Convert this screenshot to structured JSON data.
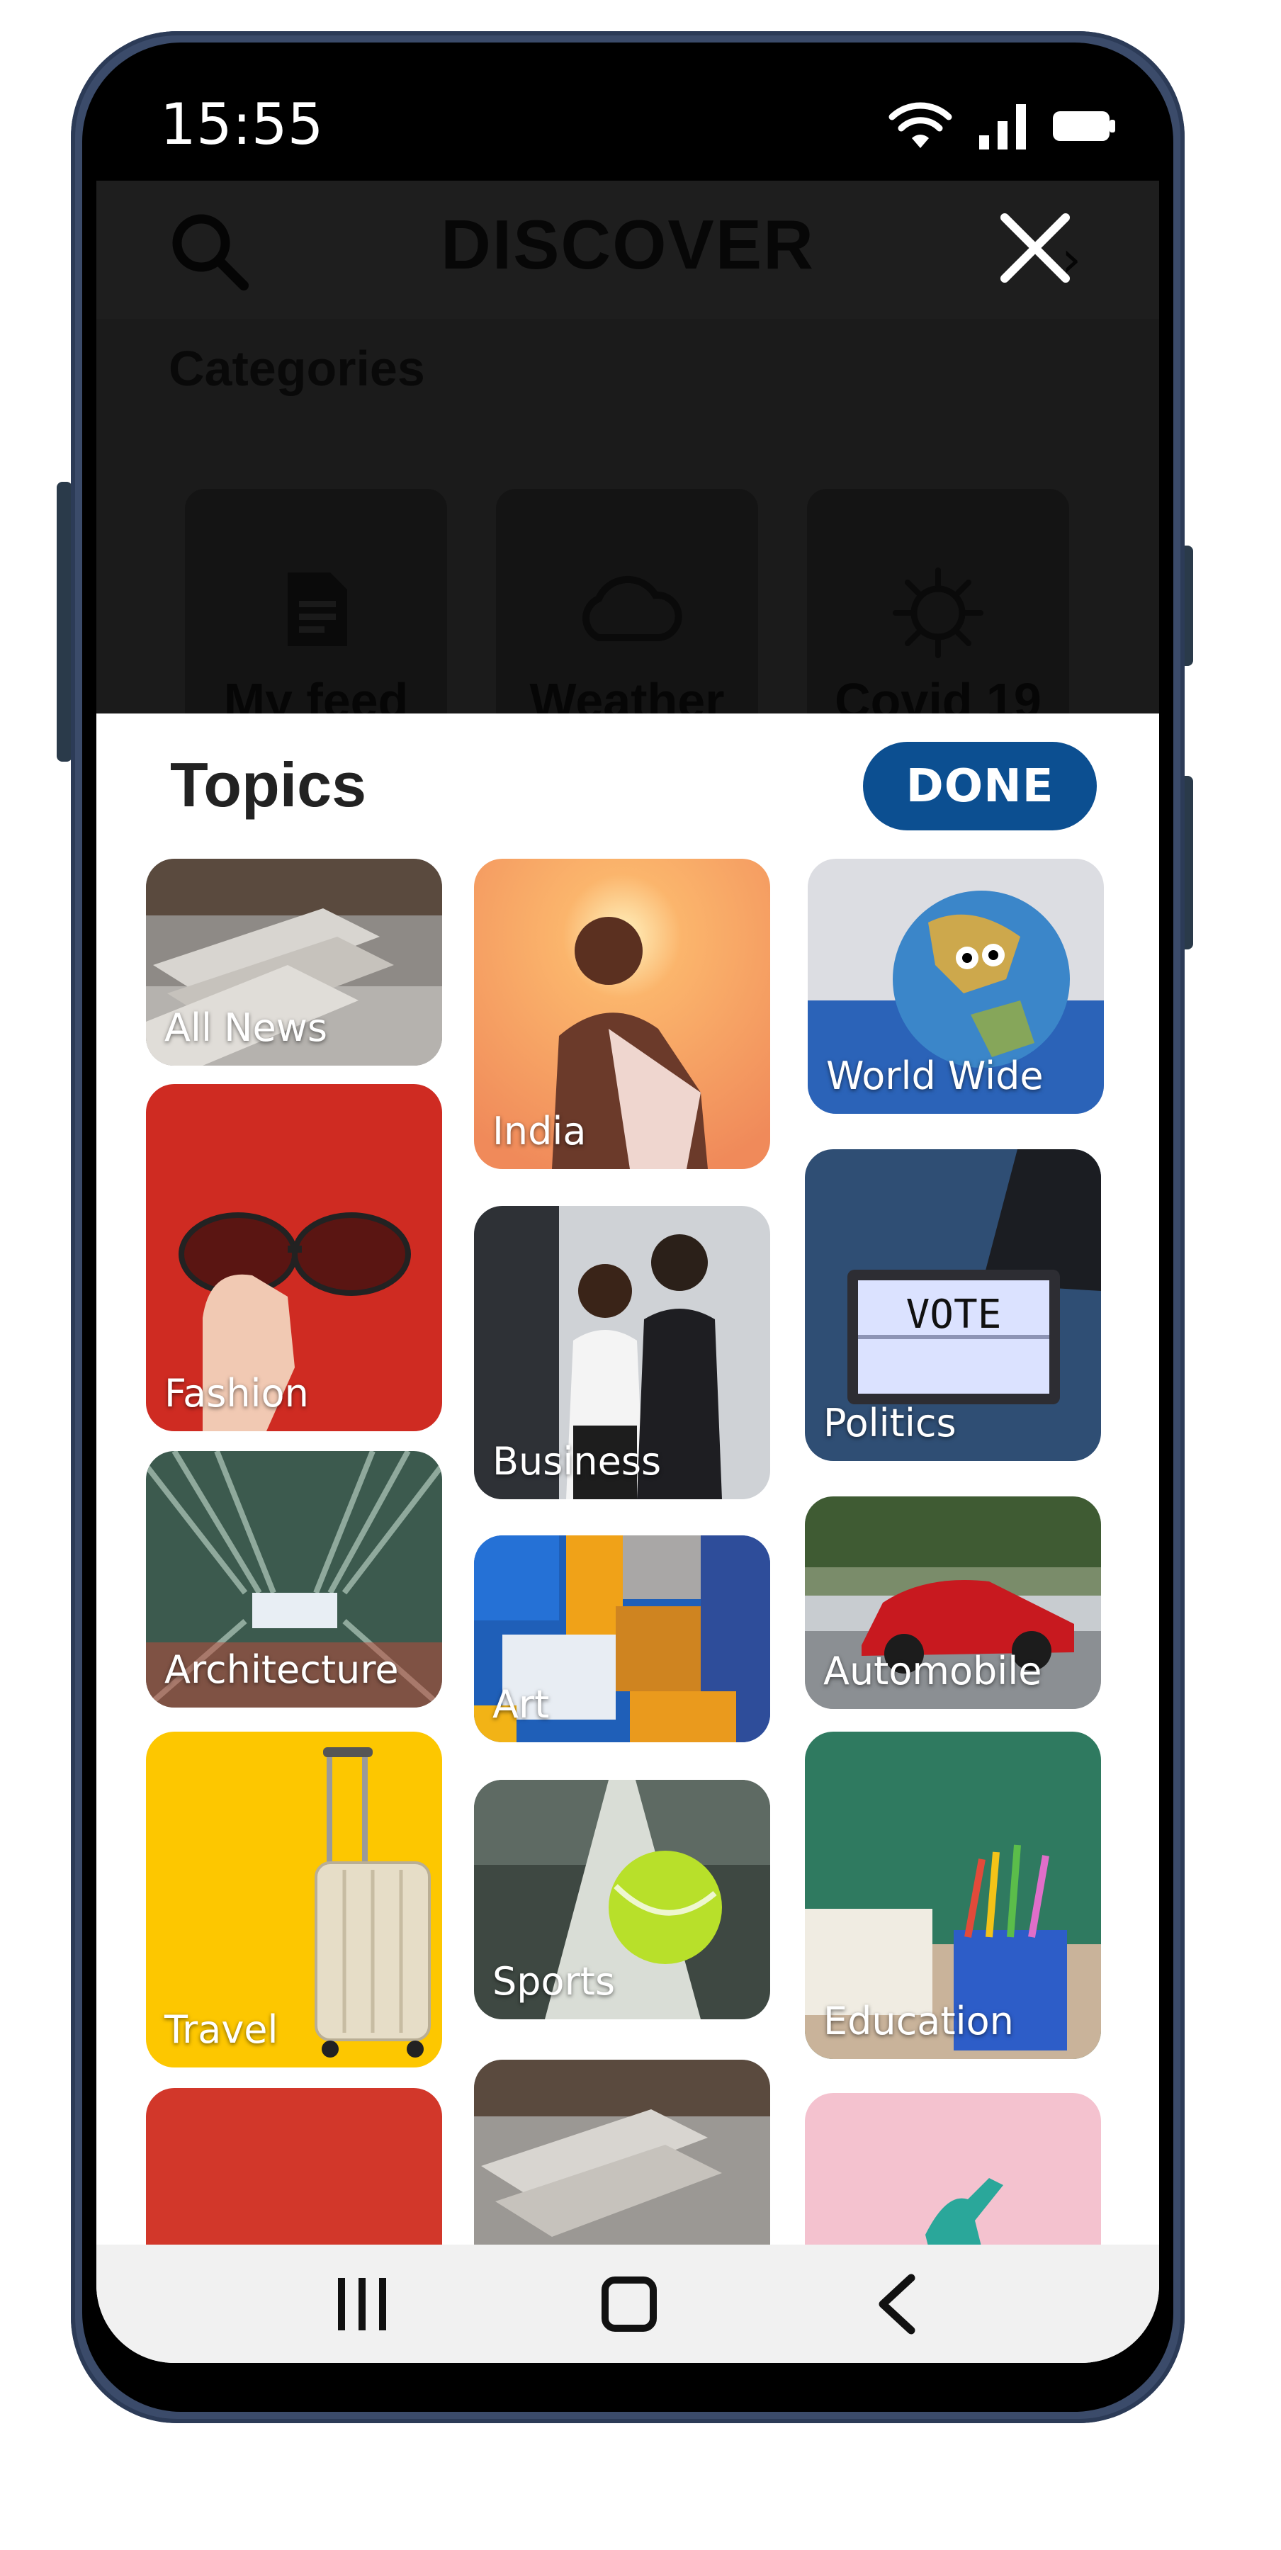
{
  "status_bar": {
    "time": "15:55",
    "icons": [
      "wifi-icon",
      "signal-icon",
      "battery-icon"
    ]
  },
  "discover": {
    "title": "DISCOVER",
    "categories_label": "Categories",
    "categories": [
      {
        "label": "My feed",
        "icon": "document-icon"
      },
      {
        "label": "Weather",
        "icon": "cloud-icon"
      },
      {
        "label": "Covid 19",
        "icon": "virus-icon"
      }
    ]
  },
  "topics": {
    "title": "Topics",
    "done_label": "DONE",
    "items": [
      {
        "label": "All News"
      },
      {
        "label": "India"
      },
      {
        "label": "World Wide"
      },
      {
        "label": "Fashion"
      },
      {
        "label": "Business"
      },
      {
        "label": "Politics"
      },
      {
        "label": "Architecture"
      },
      {
        "label": "Art"
      },
      {
        "label": "Automobile"
      },
      {
        "label": "Travel"
      },
      {
        "label": "Sports"
      },
      {
        "label": "Education"
      }
    ],
    "vote_sign_text": "VOTE"
  },
  "colors": {
    "accent": "#0c4f91",
    "phone_frame": "#3b4b6a",
    "sheet_bg": "#ffffff",
    "dim_overlay": "#1b1b1b"
  },
  "navbar": {
    "icons": [
      "recent-apps-icon",
      "home-icon",
      "back-icon"
    ]
  }
}
